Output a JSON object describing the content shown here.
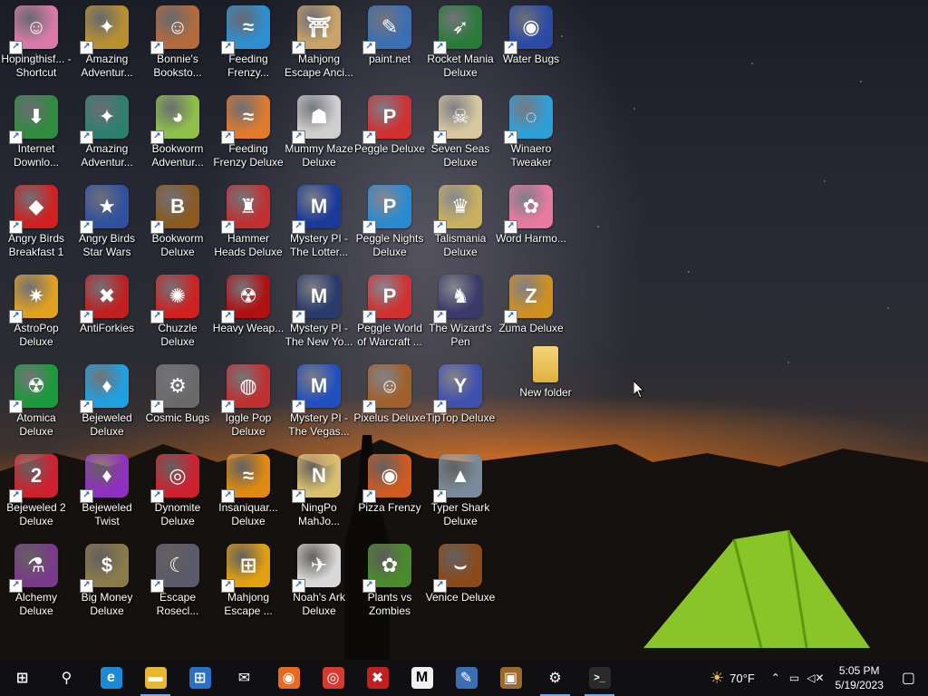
{
  "desktop": {
    "icons": [
      {
        "label": "Hopingthisf... - Shortcut",
        "icon": "girl-character-icon",
        "color": "#d87aa8",
        "glyph": "☺",
        "shortcut": true
      },
      {
        "label": "Amazing Adventur...",
        "icon": "compass-gem-icon",
        "color": "#b89030",
        "glyph": "✦",
        "shortcut": true
      },
      {
        "label": "Bonnie's Booksto...",
        "icon": "bonnie-girl-icon",
        "color": "#b46a3c",
        "glyph": "☺",
        "shortcut": true
      },
      {
        "label": "Feeding Frenzy...",
        "icon": "fish-icon",
        "color": "#2d8fd0",
        "glyph": "≈",
        "shortcut": true
      },
      {
        "label": "Mahjong Escape Anci...",
        "icon": "temple-gate-icon",
        "color": "#c9a36a",
        "glyph": "⛩",
        "shortcut": true
      },
      {
        "label": "paint.net",
        "icon": "paint-net-icon",
        "color": "#3a6fb5",
        "glyph": "✎",
        "shortcut": true
      },
      {
        "label": "Rocket Mania Deluxe",
        "icon": "rocket-icon",
        "color": "#2a7a3a",
        "glyph": "➶",
        "shortcut": true
      },
      {
        "label": "Water Bugs",
        "icon": "water-bugs-icon",
        "color": "#2a4aa5",
        "glyph": "◉",
        "shortcut": true
      },
      {
        "label": "Internet Downlo...",
        "icon": "idm-globe-icon",
        "color": "#2f8b3e",
        "glyph": "⬇",
        "shortcut": true
      },
      {
        "label": "Amazing Adventur...",
        "icon": "compass-globe-icon",
        "color": "#2d7f6f",
        "glyph": "✦",
        "shortcut": true
      },
      {
        "label": "Bookworm Adventur...",
        "icon": "bookworm-icon",
        "color": "#8fc04a",
        "glyph": "◕",
        "shortcut": true
      },
      {
        "label": "Feeding Frenzy Deluxe",
        "icon": "tropical-fish-icon",
        "color": "#e07a2c",
        "glyph": "≈",
        "shortcut": true
      },
      {
        "label": "Mummy Maze Deluxe",
        "icon": "mummy-icon",
        "color": "#cfcfcf",
        "glyph": "☗",
        "shortcut": true
      },
      {
        "label": "Peggle Deluxe",
        "icon": "peggle-icon",
        "color": "#d03030",
        "glyph": "P",
        "shortcut": true
      },
      {
        "label": "Seven Seas Deluxe",
        "icon": "skull-icon",
        "color": "#d8c8a0",
        "glyph": "☠",
        "shortcut": true
      },
      {
        "label": "Winaero Tweaker",
        "icon": "winaero-icon",
        "color": "#2ea0d8",
        "glyph": "◌",
        "shortcut": true
      },
      {
        "label": "Angry Birds Breakfast 1",
        "icon": "angry-bird-icon",
        "color": "#d02020",
        "glyph": "◆",
        "shortcut": true
      },
      {
        "label": "Angry Birds Star Wars",
        "icon": "star-wars-bird-icon",
        "color": "#3050a0",
        "glyph": "★",
        "shortcut": true
      },
      {
        "label": "Bookworm Deluxe",
        "icon": "book-icon",
        "color": "#8a5a20",
        "glyph": "B",
        "shortcut": true
      },
      {
        "label": "Hammer Heads Deluxe",
        "icon": "gnome-icon",
        "color": "#c03030",
        "glyph": "♜",
        "shortcut": true
      },
      {
        "label": "Mystery PI - The Lotter...",
        "icon": "mystery-pi-icon",
        "color": "#1a3a9a",
        "glyph": "M",
        "shortcut": true
      },
      {
        "label": "Peggle Nights Deluxe",
        "icon": "peggle-nights-icon",
        "color": "#2a8ad0",
        "glyph": "P",
        "shortcut": true
      },
      {
        "label": "Talismania Deluxe",
        "icon": "talisman-icon",
        "color": "#c8b060",
        "glyph": "♛",
        "shortcut": true
      },
      {
        "label": "Word Harmo...",
        "icon": "flower-icon",
        "color": "#e87aa0",
        "glyph": "✿",
        "shortcut": true
      },
      {
        "label": "AstroPop Deluxe",
        "icon": "astropop-icon",
        "color": "#e0a020",
        "glyph": "✷",
        "shortcut": true
      },
      {
        "label": "AntiForkies",
        "icon": "antiforkies-icon",
        "color": "#c02020",
        "glyph": "✖",
        "shortcut": true
      },
      {
        "label": "Chuzzle Deluxe",
        "icon": "chuzzle-icon",
        "color": "#d02020",
        "glyph": "✺",
        "shortcut": true
      },
      {
        "label": "Heavy Weap...",
        "icon": "radiation-icon",
        "color": "#b01010",
        "glyph": "☢",
        "shortcut": true
      },
      {
        "label": "Mystery PI - The New Yo...",
        "icon": "mystery-pi-badge-icon",
        "color": "#2a3a6a",
        "glyph": "M",
        "shortcut": true
      },
      {
        "label": "Peggle World of Warcraft ...",
        "icon": "peggle-wow-icon",
        "color": "#d03030",
        "glyph": "P",
        "shortcut": true
      },
      {
        "label": "The Wizard's Pen",
        "icon": "wizard-icon",
        "color": "#3a3a6a",
        "glyph": "♞",
        "shortcut": true
      },
      {
        "label": "Zuma Deluxe",
        "icon": "zuma-icon",
        "color": "#d09020",
        "glyph": "Z",
        "shortcut": true
      },
      {
        "label": "Atomica Deluxe",
        "icon": "atomica-icon",
        "color": "#1a9a3a",
        "glyph": "☢",
        "shortcut": true
      },
      {
        "label": "Bejeweled Deluxe",
        "icon": "diamond-icon",
        "color": "#20a0e0",
        "glyph": "♦",
        "shortcut": true
      },
      {
        "label": "Cosmic Bugs",
        "icon": "gear-bug-icon",
        "color": "#6a6a6a",
        "glyph": "⚙",
        "shortcut": true
      },
      {
        "label": "Iggle Pop Deluxe",
        "icon": "iggle-pop-icon",
        "color": "#c03030",
        "glyph": "◍",
        "shortcut": true
      },
      {
        "label": "Mystery PI - The Vegas...",
        "icon": "mystery-pi-vegas-icon",
        "color": "#2050c0",
        "glyph": "M",
        "shortcut": true
      },
      {
        "label": "Pixelus Deluxe",
        "icon": "pixelus-character-icon",
        "color": "#a0602a",
        "glyph": "☺",
        "shortcut": true
      },
      {
        "label": "TipTop Deluxe",
        "icon": "cocktail-icon",
        "color": "#4050b0",
        "glyph": "Y",
        "shortcut": true
      },
      {
        "label": "Bejeweled 2 Deluxe",
        "icon": "bejeweled-2-icon",
        "color": "#d02030",
        "glyph": "2",
        "shortcut": true
      },
      {
        "label": "Bejeweled Twist",
        "icon": "gem-twist-icon",
        "color": "#9030c0",
        "glyph": "♦",
        "shortcut": true
      },
      {
        "label": "Dynomite Deluxe",
        "icon": "egg-icon",
        "color": "#d02030",
        "glyph": "◎",
        "shortcut": true
      },
      {
        "label": "Insaniquar... Deluxe",
        "icon": "goldfish-icon",
        "color": "#e08a10",
        "glyph": "≈",
        "shortcut": true
      },
      {
        "label": "NingPo MahJo...",
        "icon": "mahjong-tile-icon",
        "color": "#d8c070",
        "glyph": "N",
        "shortcut": true
      },
      {
        "label": "Pizza Frenzy",
        "icon": "pizza-icon",
        "color": "#d05a20",
        "glyph": "◉",
        "shortcut": true
      },
      {
        "label": "Typer Shark Deluxe",
        "icon": "shark-icon",
        "color": "#7a8a9a",
        "glyph": "▲",
        "shortcut": true
      },
      {
        "label": "Alchemy Deluxe",
        "icon": "alchemist-icon",
        "color": "#7a3a8a",
        "glyph": "⚗",
        "shortcut": true
      },
      {
        "label": "Big Money Deluxe",
        "icon": "money-bag-icon",
        "color": "#8a7a4a",
        "glyph": "$",
        "shortcut": true
      },
      {
        "label": "Escape Rosecl...",
        "icon": "crescent-moon-icon",
        "color": "#5a5a6a",
        "glyph": "☾",
        "shortcut": true
      },
      {
        "label": "Mahjong Escape ...",
        "icon": "mahjong-escape-icon",
        "color": "#e0a010",
        "glyph": "⊞",
        "shortcut": true
      },
      {
        "label": "Noah's Ark Deluxe",
        "icon": "dove-icon",
        "color": "#d8d8d8",
        "glyph": "✈",
        "shortcut": true
      },
      {
        "label": "Plants vs Zombies",
        "icon": "plant-icon",
        "color": "#4a8a2a",
        "glyph": "✿",
        "shortcut": true
      },
      {
        "label": "Venice Deluxe",
        "icon": "gondola-icon",
        "color": "#8a4a1a",
        "glyph": "⌣",
        "shortcut": true
      },
      {
        "label": "New folder",
        "icon": "folder-icon",
        "color": "#e8c060",
        "glyph": "",
        "shortcut": false
      }
    ]
  },
  "taskbar": {
    "items": [
      {
        "name": "start-button",
        "icon": "windows-logo-icon",
        "glyph": "⊞",
        "color": "#101012"
      },
      {
        "name": "search-button",
        "icon": "search-icon",
        "glyph": "⚲",
        "color": "#101012"
      },
      {
        "name": "edge-button",
        "icon": "edge-icon",
        "glyph": "e",
        "color": "#1a8ad8"
      },
      {
        "name": "file-explorer-button",
        "icon": "folder-icon",
        "glyph": "▬",
        "color": "#e8b830",
        "active": true
      },
      {
        "name": "store-button",
        "icon": "store-icon",
        "glyph": "⊞",
        "color": "#2a70c8"
      },
      {
        "name": "mail-button",
        "icon": "mail-icon",
        "glyph": "✉",
        "color": "#101012"
      },
      {
        "name": "firefox-button",
        "icon": "firefox-icon",
        "glyph": "◉",
        "color": "#e86a20"
      },
      {
        "name": "chrome-button",
        "icon": "chrome-icon",
        "glyph": "◎",
        "color": "#d83a30"
      },
      {
        "name": "antiforkies-button",
        "icon": "antiforkies-icon",
        "glyph": "✖",
        "color": "#c02020"
      },
      {
        "name": "m-app-button",
        "icon": "m-logo-icon",
        "glyph": "M",
        "color": "#f0f0f0"
      },
      {
        "name": "paint-net-button",
        "icon": "paint-net-icon",
        "glyph": "✎",
        "color": "#3a6fb5"
      },
      {
        "name": "winrar-button",
        "icon": "archive-icon",
        "glyph": "▣",
        "color": "#9a6a2a"
      },
      {
        "name": "settings-button",
        "icon": "gear-icon",
        "glyph": "⚙",
        "color": "#101012",
        "active": true
      },
      {
        "name": "terminal-button",
        "icon": "terminal-icon",
        "glyph": ">_",
        "color": "#2a2a2a",
        "active": true
      }
    ],
    "weather": {
      "temp": "70°F",
      "icon": "partly-sunny-icon"
    },
    "clock": {
      "time": "5:05 PM",
      "date": "5/19/2023"
    }
  }
}
